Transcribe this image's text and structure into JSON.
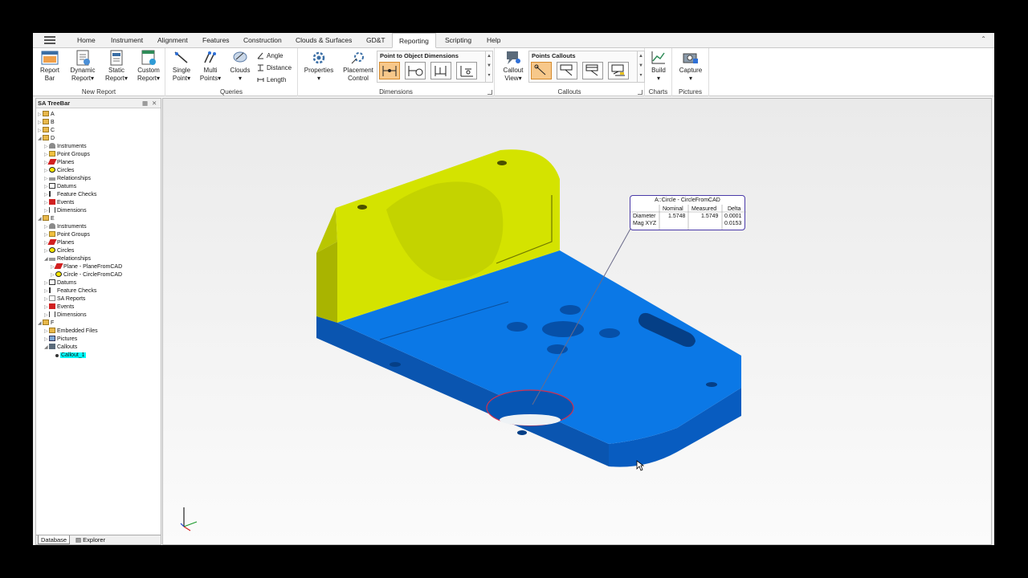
{
  "menu": {
    "tabs": [
      "Home",
      "Instrument",
      "Alignment",
      "Features",
      "Construction",
      "Clouds & Surfaces",
      "GD&T",
      "Reporting",
      "Scripting",
      "Help"
    ],
    "active_tab": "Reporting"
  },
  "ribbon": {
    "new_report": {
      "label": "New Report",
      "buttons": [
        {
          "line1": "Report",
          "line2": "Bar"
        },
        {
          "line1": "Dynamic",
          "line2": "Report"
        },
        {
          "line1": "Static",
          "line2": "Report"
        },
        {
          "line1": "Custom",
          "line2": "Report"
        }
      ]
    },
    "queries": {
      "label": "Queries",
      "buttons": [
        {
          "line1": "Single",
          "line2": "Point"
        },
        {
          "line1": "Multi",
          "line2": "Points"
        },
        {
          "line1": "Clouds",
          "line2": ""
        }
      ],
      "small_buttons": [
        "Angle",
        "Distance",
        "Length"
      ]
    },
    "dimensions": {
      "label": "Dimensions",
      "buttons": [
        {
          "line1": "Properties",
          "line2": ""
        },
        {
          "line1": "Placement",
          "line2": "Control"
        }
      ],
      "gallery_title": "Point to Object Dimensions"
    },
    "callouts": {
      "label": "Callouts",
      "buttons": [
        {
          "line1": "Callout",
          "line2": "View"
        }
      ],
      "gallery_title": "Points Callouts"
    },
    "charts": {
      "label": "Charts",
      "buttons": [
        {
          "line1": "Build",
          "line2": ""
        }
      ]
    },
    "pictures": {
      "label": "Pictures",
      "buttons": [
        {
          "line1": "Capture",
          "line2": ""
        }
      ]
    }
  },
  "treebar": {
    "title": "SA TreeBar",
    "nodes": [
      {
        "label": "A",
        "level": 0,
        "icon": "folder",
        "expanded": false
      },
      {
        "label": "B",
        "level": 0,
        "icon": "folder",
        "expanded": false
      },
      {
        "label": "C",
        "level": 0,
        "icon": "folder",
        "expanded": false
      },
      {
        "label": "D",
        "level": 0,
        "icon": "folder",
        "expanded": true
      },
      {
        "label": "Instruments",
        "level": 1,
        "icon": "instrument",
        "expanded": false
      },
      {
        "label": "Point Groups",
        "level": 1,
        "icon": "point-group",
        "expanded": false
      },
      {
        "label": "Planes",
        "level": 1,
        "icon": "plane",
        "expanded": false
      },
      {
        "label": "Circles",
        "level": 1,
        "icon": "circle",
        "expanded": false
      },
      {
        "label": "Relationships",
        "level": 1,
        "icon": "relationship",
        "expanded": false
      },
      {
        "label": "Datums",
        "level": 1,
        "icon": "datum",
        "expanded": false
      },
      {
        "label": "Feature Checks",
        "level": 1,
        "icon": "feature-check",
        "expanded": false
      },
      {
        "label": "Events",
        "level": 1,
        "icon": "event",
        "expanded": false
      },
      {
        "label": "Dimensions",
        "level": 1,
        "icon": "dimension",
        "expanded": false
      },
      {
        "label": "E",
        "level": 0,
        "icon": "folder",
        "expanded": true
      },
      {
        "label": "Instruments",
        "level": 1,
        "icon": "instrument",
        "expanded": false
      },
      {
        "label": "Point Groups",
        "level": 1,
        "icon": "point-group",
        "expanded": false
      },
      {
        "label": "Planes",
        "level": 1,
        "icon": "plane",
        "expanded": false
      },
      {
        "label": "Circles",
        "level": 1,
        "icon": "circle",
        "expanded": false
      },
      {
        "label": "Relationships",
        "level": 1,
        "icon": "relationship",
        "expanded": true
      },
      {
        "label": "Plane - PlaneFromCAD",
        "level": 2,
        "icon": "plane",
        "expanded": false
      },
      {
        "label": "Circle - CircleFromCAD",
        "level": 2,
        "icon": "circle",
        "expanded": false
      },
      {
        "label": "Datums",
        "level": 1,
        "icon": "datum",
        "expanded": false
      },
      {
        "label": "Feature Checks",
        "level": 1,
        "icon": "feature-check",
        "expanded": false
      },
      {
        "label": "SA Reports",
        "level": 1,
        "icon": "report",
        "expanded": false
      },
      {
        "label": "Events",
        "level": 1,
        "icon": "event",
        "expanded": false
      },
      {
        "label": "Dimensions",
        "level": 1,
        "icon": "dimension",
        "expanded": false
      },
      {
        "label": "F",
        "level": 0,
        "icon": "folder",
        "expanded": true
      },
      {
        "label": "Embedded Files",
        "level": 1,
        "icon": "embedded-files",
        "expanded": false
      },
      {
        "label": "Pictures",
        "level": 1,
        "icon": "picture",
        "expanded": false
      },
      {
        "label": "Callouts",
        "level": 1,
        "icon": "callout",
        "expanded": true
      },
      {
        "label": "Callout_1",
        "level": 2,
        "icon": "dot",
        "expanded": false,
        "selected": true
      }
    ],
    "bottom_tabs": [
      "Database",
      "Explorer"
    ],
    "active_bottom_tab": "Database"
  },
  "callout": {
    "title": "A::Circle - CircleFromCAD",
    "headers": [
      "Nominal",
      "Measured",
      "Delta"
    ],
    "rows": [
      {
        "label": "Diameter",
        "nominal": "1.5748",
        "measured": "1.5749",
        "delta": "0.0001"
      },
      {
        "label": "Mag XYZ",
        "nominal": "",
        "measured": "",
        "delta": "0.0153"
      }
    ]
  },
  "colors": {
    "part_yellow": "#c8d800",
    "part_blue": "#0a6fd8",
    "callout_border": "#4a3aa8",
    "selection": "#00ffff",
    "active_gallery_item": "#f7c88a"
  }
}
